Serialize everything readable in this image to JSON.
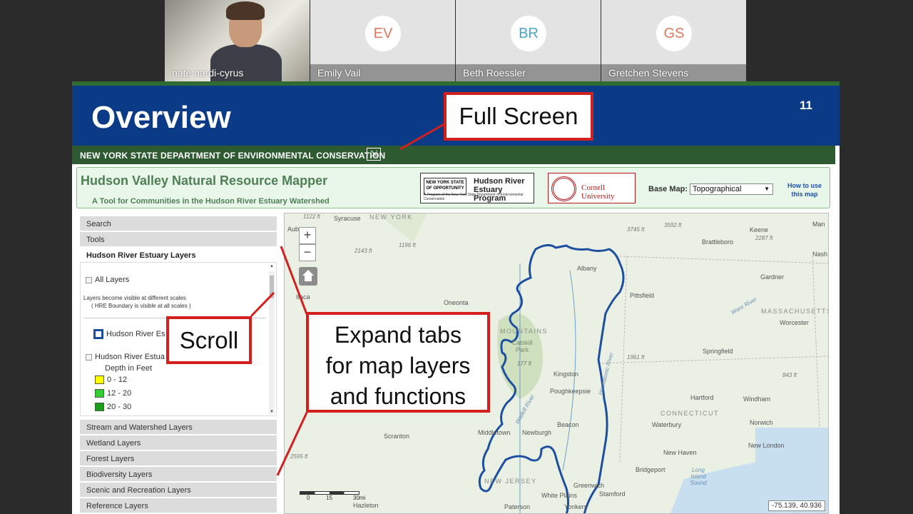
{
  "participants": [
    {
      "name": "nate nardi-cyrus",
      "initials": "",
      "video": true
    },
    {
      "name": "Emily Vail",
      "initials": "EV",
      "color": "#e07a5f"
    },
    {
      "name": "Beth Roessler",
      "initials": "BR",
      "color": "#4aa3c9"
    },
    {
      "name": "Gretchen Stevens",
      "initials": "GS",
      "color": "#e07a5f"
    }
  ],
  "slide": {
    "title": "Overview",
    "number": "11"
  },
  "dec_bar": {
    "text": "NEW YORK STATE DEPARTMENT OF ENVIRONMENTAL CONSERVATION",
    "fullscreen_icon": "expand-icon"
  },
  "app": {
    "title": "Hudson Valley Natural Resource Mapper",
    "subtitle": "A Tool for Communities in the Hudson River Estuary Watershed",
    "ny_logo": {
      "state": "NEW YORK STATE OF OPPORTUNITY",
      "program_line1": "Hudson River",
      "program_line2": "Estuary Program",
      "tagline": "A Program of the New York State Department of Environmental Conservation"
    },
    "cornell_logo": "Cornell University",
    "base_map_label": "Base Map:",
    "base_map_value": "Topographical",
    "how_to_line1": "How to use",
    "how_to_line2": "this map"
  },
  "sidebar": {
    "tabs_top": [
      "Search",
      "Tools",
      "Hudson River Estuary Layers"
    ],
    "all_layers": "All Layers",
    "note_line1": "Layers become visible at different scales",
    "note_line2": "( HRE Boundary is visible at all scales )",
    "layer1": "Hudson River Es",
    "layer2": "Hudson River Estua",
    "depth_label": "Depth in Feet",
    "legend": [
      {
        "label": "0 - 12",
        "color": "#ffff00"
      },
      {
        "label": "12 - 20",
        "color": "#33cc33"
      },
      {
        "label": "20 - 30",
        "color": "#1a9e1a"
      }
    ],
    "tabs_bottom": [
      "Stream and Watershed Layers",
      "Wetland Layers",
      "Forest Layers",
      "Biodiversity Layers",
      "Scenic and Recreation Layers",
      "Reference Layers"
    ]
  },
  "map": {
    "zoom_in": "+",
    "zoom_out": "−",
    "coords": "-75.139, 40.936",
    "scale_labels": [
      "0",
      "15",
      "30mi"
    ],
    "places": {
      "syracuse": "Syracuse",
      "new_york": "NEW YORK",
      "auburn": "Aub",
      "ithaca": "Itaca",
      "oneonta": "Oneonta",
      "albany": "Albany",
      "pittsfield": "Pittsfield",
      "keene": "Keene",
      "brattleboro": "Brattleboro",
      "man": "Man",
      "nash": "Nash",
      "gardner": "Gardner",
      "massachusetts": "MASSACHUSETTS",
      "worcester": "Worcester",
      "springfield": "Springfield",
      "mountains": "MOUNTAINS",
      "catskill": "Catskill Park",
      "kingston": "Kingston",
      "poughkeepsie": "Poughkeepsie",
      "hartford": "Hartford",
      "windham": "Windham",
      "connecticut": "CONNECTICUT",
      "beacon": "Beacon",
      "waterbury": "Waterbury",
      "norwich": "Norwich",
      "middletown": "Middletown",
      "newburgh": "Newburgh",
      "scranton": "Scranton",
      "new_haven": "New Haven",
      "new_london": "New London",
      "bridgeport": "Bridgeport",
      "long_island": "Long Island Sound",
      "new_jersey": "NEW JERSEY",
      "greenwich": "Greenwich",
      "stamford": "Stamford",
      "white_plains": "White Plains",
      "yonkers": "Yonkers",
      "paterson": "Paterson",
      "hazleton": "Hazleton",
      "ware": "Ware River",
      "housatonic": "Housatonic River",
      "wallkill": "Wallkill River"
    },
    "elevations": [
      "1122 ft",
      "2143 ft",
      "1196 ft",
      "3745 ft",
      "3592 ft",
      "2287 ft",
      "1961 ft",
      "843 ft",
      "2595 ft",
      "177 ft"
    ]
  },
  "callouts": {
    "full_screen": "Full Screen",
    "scroll": "Scroll",
    "expand_line1": "Expand tabs",
    "expand_line2": "for map layers",
    "expand_line3": "and functions"
  },
  "colors": {
    "slide_band": "#0b3a86",
    "dec_bar": "#2d5a30",
    "callout_border": "#d41f1f",
    "boundary": "#1d4fa0"
  }
}
